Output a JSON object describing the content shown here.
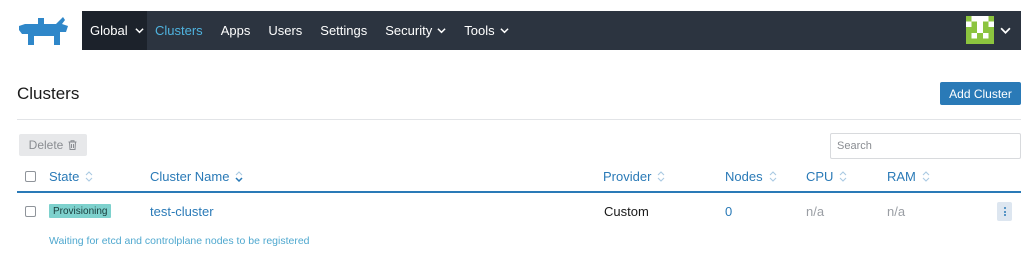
{
  "nav": {
    "global": "Global",
    "items": [
      {
        "label": "Clusters",
        "active": true,
        "dropdown": false
      },
      {
        "label": "Apps",
        "active": false,
        "dropdown": false
      },
      {
        "label": "Users",
        "active": false,
        "dropdown": false
      },
      {
        "label": "Settings",
        "active": false,
        "dropdown": false
      },
      {
        "label": "Security",
        "active": false,
        "dropdown": true
      },
      {
        "label": "Tools",
        "active": false,
        "dropdown": true
      }
    ]
  },
  "page": {
    "title": "Clusters",
    "add_button": "Add Cluster"
  },
  "toolbar": {
    "delete_label": "Delete",
    "search_placeholder": "Search"
  },
  "table": {
    "columns": [
      "State",
      "Cluster Name",
      "Provider",
      "Nodes",
      "CPU",
      "RAM"
    ],
    "rows": [
      {
        "state": "Provisioning",
        "name": "test-cluster",
        "provider": "Custom",
        "nodes": "0",
        "cpu": "n/a",
        "ram": "n/a",
        "message": "Waiting for etcd and controlplane nodes to be registered"
      }
    ]
  },
  "colors": {
    "nav_bg": "#2c3440",
    "nav_global_bg": "#1c222b",
    "accent": "#2a7ab7",
    "active_link": "#4fb3df",
    "badge": "#7dd1cd"
  },
  "icons": [
    "rancher-logo-icon",
    "chevron-down-icon",
    "trash-icon",
    "sort-icon",
    "kebab-menu-icon",
    "avatar-icon"
  ]
}
